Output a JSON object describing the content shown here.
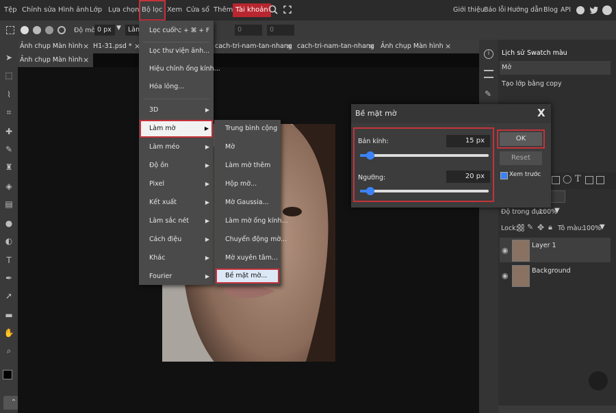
{
  "menubar": {
    "items": [
      "Tệp",
      "Chỉnh sửa",
      "Hình ảnh",
      "Lớp",
      "Lựa chọn",
      "Bộ lọc",
      "Xem",
      "Cửa sổ",
      "Thêm",
      "Tài khoản"
    ],
    "right_links": [
      "Giới thiệu",
      "Báo lỗi",
      "Hướng dẫn",
      "Blog",
      "API"
    ]
  },
  "options": {
    "blur_label": "Độ mờ:",
    "blur_value": "0 px",
    "field_a": "0",
    "field_b": "0",
    "lam_label": "Làm"
  },
  "tabs": {
    "row1": [
      {
        "label": "Ảnh chụp Màn hình",
        "close": "×"
      },
      {
        "label": "H1-31.psd *",
        "close": "×"
      },
      {
        "label": "cach-tri-nam-tan-nhang",
        "close": "×"
      },
      {
        "label": "cach-tri-nam-tan-nhang",
        "close": "×"
      },
      {
        "label": "Ảnh chụp Màn hình",
        "close": "×"
      }
    ],
    "row2": [
      {
        "label": "Ảnh chụp Màn hình",
        "close": "×"
      }
    ]
  },
  "filter_menu": {
    "items": [
      {
        "label": "Lọc cuối",
        "shortcut": "⌥ + ⌘ + F"
      },
      {
        "label": "Lọc thư viện ảnh..."
      },
      {
        "label": "Hiệu chỉnh ống kính..."
      },
      {
        "label": "Hóa lỏng..."
      },
      {
        "label": "3D"
      },
      {
        "label": "Làm mờ"
      },
      {
        "label": "Làm méo"
      },
      {
        "label": "Độ ồn"
      },
      {
        "label": "Pixel"
      },
      {
        "label": "Kết xuất"
      },
      {
        "label": "Làm sắc nét"
      },
      {
        "label": "Cách điệu"
      },
      {
        "label": "Khác"
      },
      {
        "label": "Fourier"
      }
    ],
    "arrow": "▶"
  },
  "blur_menu": {
    "items": [
      "Trung bình cộng",
      "Mờ",
      "Làm mờ thêm",
      "Hộp mờ...",
      "Mờ Gaussia...",
      "Làm mờ ống kính...",
      "Chuyển động mờ...",
      "Mờ xuyên tâm...",
      "Bề mặt mờ..."
    ]
  },
  "dialog": {
    "title": "Bề mặt mờ",
    "close": "X",
    "radius_label": "Bán kính:",
    "radius_value": "15",
    "radius_unit": "px",
    "radius_fraction": 0.08,
    "threshold_label": "Ngưỡng:",
    "threshold_value": "20",
    "threshold_unit": "px",
    "threshold_fraction": 0.08,
    "ok": "OK",
    "reset": "Reset",
    "preview_label": "Xem trước"
  },
  "right_panel": {
    "tab_history": "Lịch sử",
    "tab_swatch": "Swatch màu",
    "history_items": [
      "Mở",
      "Tạo lớp bằng copy"
    ],
    "opacity_label": "Độ trong đục:",
    "opacity_value": "100%",
    "lock_label": "Lock:",
    "fill_label": "Tô màu:",
    "fill_value": "100%",
    "layers": [
      {
        "name": "Layer 1"
      },
      {
        "name": "Background"
      }
    ]
  },
  "colors": {
    "accent_red": "#c6323a",
    "slider_blue": "#3b82f6",
    "menu_bg": "#4a4a4a",
    "selected_bg": "#f2f2f2"
  }
}
